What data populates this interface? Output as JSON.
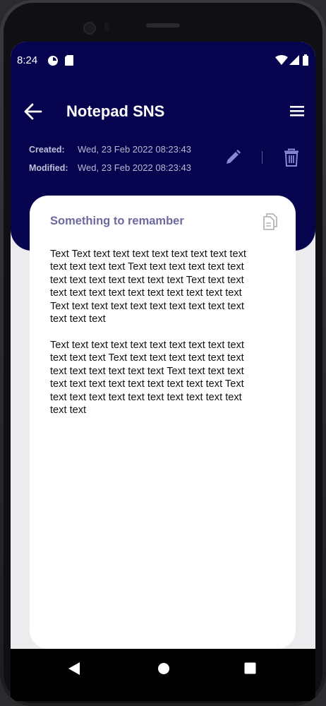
{
  "status_bar": {
    "time": "8:24",
    "icons": [
      "sync-icon",
      "sd-card-icon",
      "wifi-icon",
      "signal-icon",
      "battery-icon"
    ]
  },
  "app_bar": {
    "title": "Notepad SNS",
    "back_icon": "arrow-left-icon",
    "menu_icon": "hamburger-menu-icon"
  },
  "note_meta": {
    "created_label": "Created:",
    "created_value": "Wed, 23 Feb 2022  08:23:43",
    "modified_label": "Modified:",
    "modified_value": "Wed, 23 Feb 2022  08:23:43",
    "edit_icon": "pencil-icon",
    "delete_icon": "trash-icon"
  },
  "note": {
    "title": "Something to remamber",
    "copy_icon": "copy-icon",
    "paragraph_1_lines": [
      "Text Text text text text text text text text text",
      "text text text text Text text text text text text",
      "text text text text text text text Text text text",
      "text text text text text text text text text text",
      "Text text text text text text text text text text",
      "text text text"
    ],
    "paragraph_2_lines": [
      "Text text text text text text text text text text",
      "text text text Text text text text text text text",
      "text text text text text text Text text text text",
      "text text text text text text text text text Text",
      "text text text text text text text text text text",
      "text text"
    ]
  },
  "colors": {
    "header_bg": "#06044f",
    "card_bg": "#ffffff",
    "title_accent": "#6d6a9e",
    "screen_bg": "#ecebee"
  },
  "system_nav": {
    "icons": [
      "back-triangle-icon",
      "home-circle-icon",
      "recents-square-icon"
    ]
  }
}
